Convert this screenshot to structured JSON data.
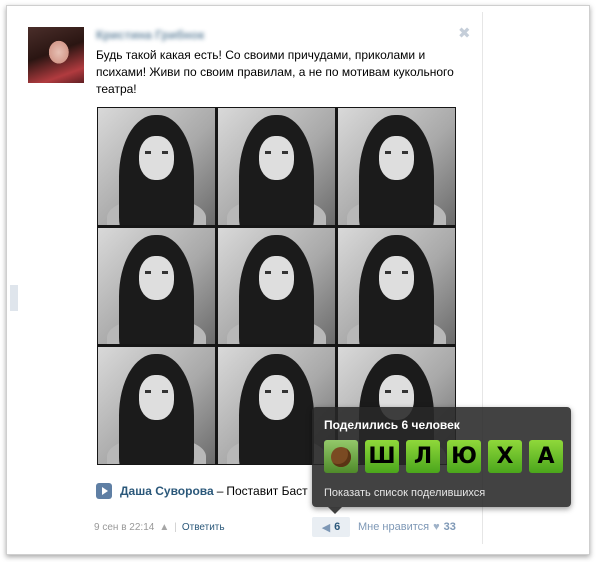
{
  "post": {
    "author_name": "Кристина Грибнок",
    "close_symbol": "✖",
    "text": "Будь такой какая есть! Со своими причудами, приколами и психами! Живи по своим правилам, а не по мотивам кукольного театра!",
    "photos_count": 9
  },
  "audio": {
    "artist": "Даша Суворова",
    "separator": "–",
    "title": "Поставит Баст"
  },
  "meta": {
    "date": "9 сен в 22:14",
    "separator": "|",
    "reply_label": "Ответить"
  },
  "share": {
    "count": "6"
  },
  "like": {
    "label": "Мне нравится",
    "count": "33"
  },
  "tooltip": {
    "title": "Поделились 6 человек",
    "letters": [
      "Ш",
      "Л",
      "Ю",
      "Х",
      "А"
    ],
    "link": "Показать список поделившихся"
  },
  "colors": {
    "link": "#2b587a",
    "tile_green": "#6cc22a",
    "tooltip_bg": "#282828"
  }
}
